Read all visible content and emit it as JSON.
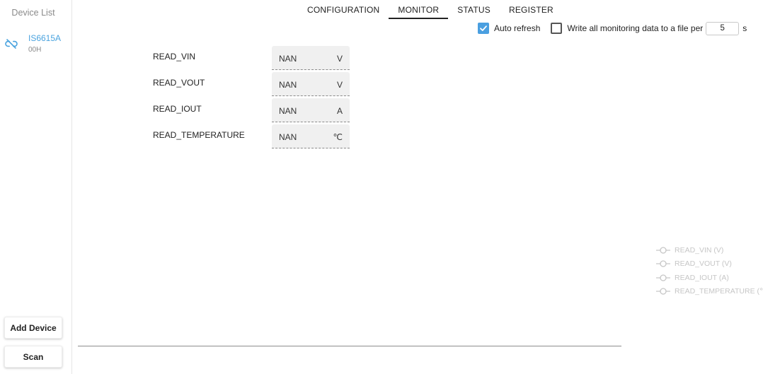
{
  "sidebar": {
    "title": "Device List",
    "device": {
      "name": "IS6615A",
      "address": "00H",
      "icon": "link-off-icon"
    },
    "add_button": "Add Device",
    "scan_button": "Scan"
  },
  "tabs": [
    {
      "label": "CONFIGURATION",
      "active": false
    },
    {
      "label": "MONITOR",
      "active": true
    },
    {
      "label": "STATUS",
      "active": false
    },
    {
      "label": "REGISTER",
      "active": false
    }
  ],
  "options": {
    "auto_refresh": {
      "label": "Auto refresh",
      "checked": true
    },
    "write_file": {
      "label": "Write all monitoring data to a file per",
      "checked": false
    },
    "period_value": "5",
    "period_unit": "s"
  },
  "monitor": [
    {
      "label": "READ_VIN",
      "value": "NAN",
      "unit": "V"
    },
    {
      "label": "READ_VOUT",
      "value": "NAN",
      "unit": "V"
    },
    {
      "label": "READ_IOUT",
      "value": "NAN",
      "unit": "A"
    },
    {
      "label": "READ_TEMPERATURE",
      "value": "NAN",
      "unit": "℃"
    }
  ],
  "legend": [
    "READ_VIN (V)",
    "READ_VOUT (V)",
    "READ_IOUT (A)",
    "READ_TEMPERATURE (℃)"
  ],
  "colors": {
    "accent": "#4a9fe0",
    "device_name": "#4aa3df",
    "legend_text": "#c6c6c6"
  }
}
